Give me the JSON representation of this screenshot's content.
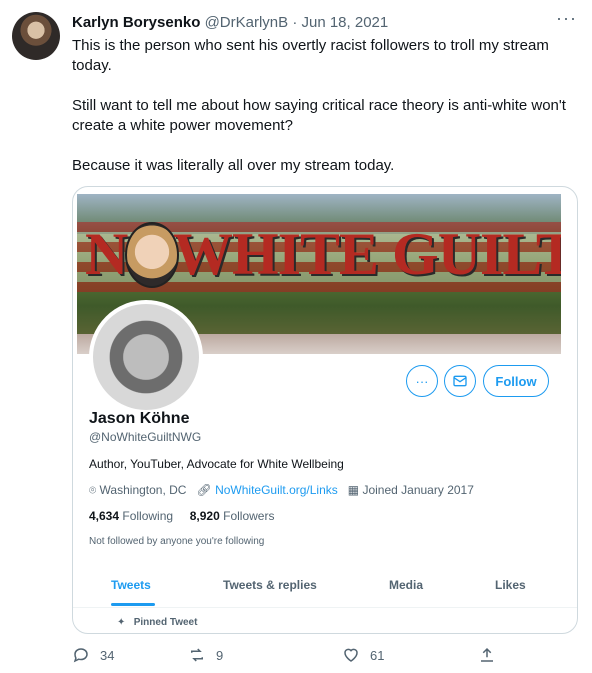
{
  "tweet": {
    "author_name": "Karlyn Borysenko",
    "author_handle": "@DrKarlynB",
    "separator": "·",
    "date": "Jun 18, 2021",
    "more": "···",
    "paragraphs": [
      "This is the person who sent his overtly racist followers to troll my stream today.",
      "Still want to tell me about how saying critical race theory is anti-white won't create a white power movement?",
      "Because it was literally all over my stream today."
    ]
  },
  "card": {
    "banner_text": "NOWHITE GUILT",
    "buttons": {
      "more": "···",
      "follow": "Follow"
    },
    "profile": {
      "name": "Jason Köhne",
      "handle": "@NoWhiteGuiltNWG",
      "bio": "Author, YouTuber, Advocate for White Wellbeing",
      "location": "Washington, DC",
      "link": "NoWhiteGuilt.org/Links",
      "joined": "Joined January 2017",
      "following_count": "4,634",
      "following_label": "Following",
      "followers_count": "8,920",
      "followers_label": "Followers",
      "followed_by": "Not followed by anyone you're following"
    },
    "tabs": [
      "Tweets",
      "Tweets & replies",
      "Media",
      "Likes"
    ],
    "active_tab": "Tweets",
    "pinned_label": "Pinned Tweet"
  },
  "actions": {
    "replies": "34",
    "retweets": "9",
    "likes": "61"
  },
  "colors": {
    "accent": "#1d9bf0",
    "muted": "#536471",
    "text": "#0f1419",
    "border": "#cfd9de"
  }
}
